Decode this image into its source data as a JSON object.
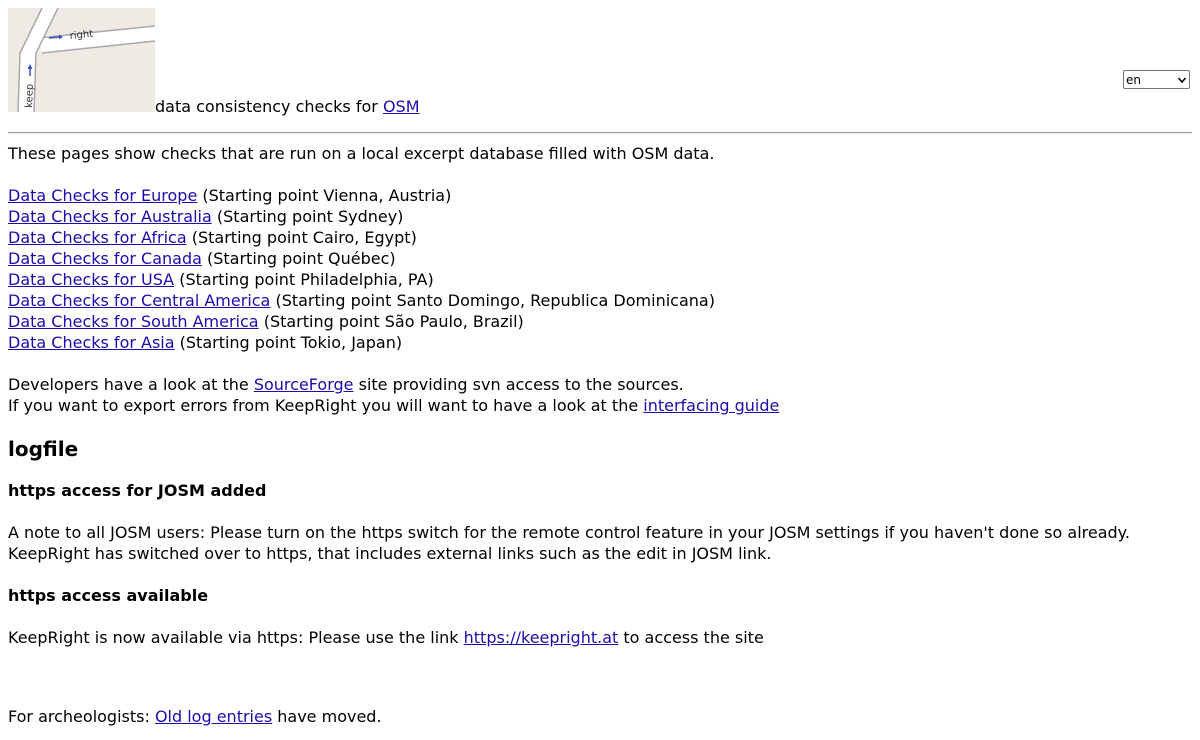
{
  "header": {
    "logo": {
      "sign_right": "right",
      "sign_keep": "keep"
    },
    "tagline_text": "data consistency checks for",
    "tagline_link": "OSM",
    "language_select": {
      "selected": "en"
    }
  },
  "intro": "These pages show checks that are run on a local excerpt database filled with OSM data.",
  "regions": [
    {
      "link": "Data Checks for Europe",
      "note": "(Starting point Vienna, Austria)"
    },
    {
      "link": "Data Checks for Australia",
      "note": "(Starting point Sydney)"
    },
    {
      "link": "Data Checks for Africa",
      "note": "(Starting point Cairo, Egypt)"
    },
    {
      "link": "Data Checks for Canada",
      "note": "(Starting point Québec)"
    },
    {
      "link": "Data Checks for USA",
      "note": "(Starting point Philadelphia, PA)"
    },
    {
      "link": "Data Checks for Central America",
      "note": "(Starting point Santo Domingo, Republica Dominicana)"
    },
    {
      "link": "Data Checks for South America",
      "note": "(Starting point São Paulo, Brazil)"
    },
    {
      "link": "Data Checks for Asia",
      "note": "(Starting point Tokio, Japan)"
    }
  ],
  "developers": {
    "line1_before": "Developers have a look at the",
    "line1_link": "SourceForge",
    "line1_after": "site providing svn access to the sources.",
    "line2_before": "If you want to export errors from KeepRight you will want to have a look at the",
    "line2_link": "interfacing guide"
  },
  "logfile": {
    "title": "logfile",
    "entries": [
      {
        "title": "https access for JOSM added",
        "body": "A note to all JOSM users: Please turn on the https switch for the remote control feature in your JOSM settings if you haven't done so already. KeepRight has switched over to https, that includes external links such as the edit in JOSM link."
      },
      {
        "title": "https access available",
        "body_before": "KeepRight is now available via https: Please use the link",
        "body_link": "https://keepright.at",
        "body_after": "to access the site"
      }
    ]
  },
  "footer": {
    "before": "For archeologists:",
    "link": "Old log entries",
    "after": "have moved."
  }
}
